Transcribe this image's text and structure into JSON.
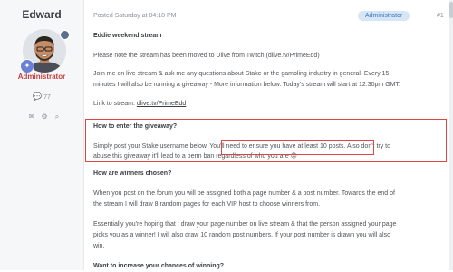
{
  "author": {
    "username": "Edward",
    "role": "Administrator",
    "post_count": "77",
    "icons": [
      "chat-icon",
      "envelope-icon",
      "gear-icon",
      "search-icon"
    ]
  },
  "header": {
    "posted": "Posted Saturday at 04:18 PM",
    "badge": "Administrator",
    "post_number": "#1"
  },
  "post": {
    "title": "Eddie weekend stream",
    "line1": "Please note the stream has been moved to Dlive from Twitch (dlive.tv/PrimeEdd)",
    "line2a": "Join me on live stream & ask me any questions about Stake or the gambling industry in general. Every 15",
    "line2b": "minutes I will also be running a giveaway - More information below. Today's stream will start at 12:30pm GMT.",
    "link_prefix": "Link to stream: ",
    "link_text": "dlive.tv/PrimeEdd",
    "enter_heading": "How to enter the giveaway?",
    "enter_a1": "Simply post your Stake username below. ",
    "enter_a2": "You'll need to ensure you have at least 10 posts.",
    "enter_a3": " Also don't try to",
    "enter_b": "abuse this giveaway it'll lead to a perm ban regardless of who you are 😡",
    "winners_heading": "How are winners chosen?",
    "win_1a": "When you post on the forum you will be assigned both a page number & a post number. Towards the end of",
    "win_1b": "the stream I will draw 8 random pages for each VIP host to choose winners from.",
    "win_2a": "Essentially you're hoping that I draw your page number on live stream & that the person assigned your page",
    "win_2b": "picks you as a winner! I will also draw 10 random post numbers. If your post number is drawn you will also",
    "win_2c": "win.",
    "increase_heading": "Want to increase your chances of winning?"
  }
}
